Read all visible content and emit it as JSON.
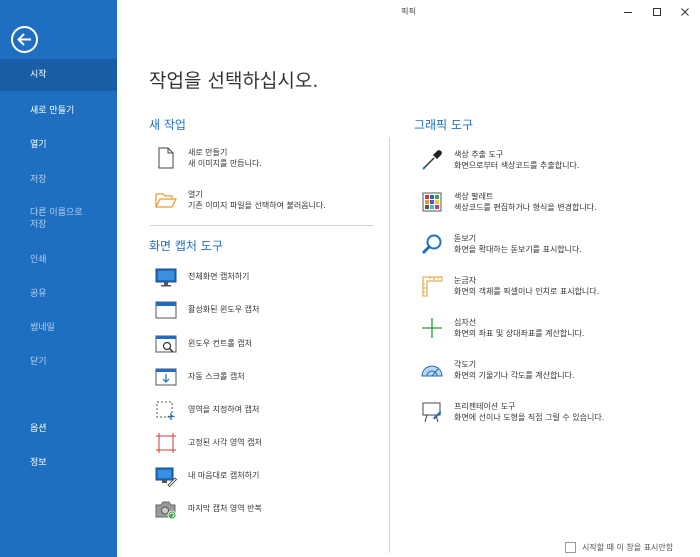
{
  "app": {
    "title": "픽픽"
  },
  "sidebar": {
    "items": [
      {
        "label": "시작"
      },
      {
        "label": "새로 만들기"
      },
      {
        "label": "열기"
      },
      {
        "label": "저장"
      },
      {
        "label": "다른 이름으로\n저장"
      },
      {
        "label": "인쇄"
      },
      {
        "label": "공유"
      },
      {
        "label": "썸네일"
      },
      {
        "label": "닫기"
      },
      {
        "label": "옵션"
      },
      {
        "label": "정보"
      }
    ]
  },
  "main": {
    "heading": "작업을 선택하십시오.",
    "new_task": {
      "title": "새 작업",
      "items": [
        {
          "name": "새로 만들기",
          "desc": "새 이미지를 만듭니다.",
          "icon": "blank-page-icon"
        },
        {
          "name": "열기",
          "desc": "기존 이미지 파일을 선택하여 불러옵니다.",
          "icon": "open-folder-icon"
        }
      ]
    },
    "capture": {
      "title": "화면 캡처 도구",
      "items": [
        {
          "label": "전체화면 캡처하기",
          "icon": "monitor-icon"
        },
        {
          "label": "활성화된 윈도우 캡처",
          "icon": "active-window-icon"
        },
        {
          "label": "윈도우 컨트롤 캡처",
          "icon": "window-control-icon"
        },
        {
          "label": "자동 스크롤 캡처",
          "icon": "scroll-capture-icon"
        },
        {
          "label": "영역을 지정하여 캡처",
          "icon": "region-select-icon"
        },
        {
          "label": "고정된 사각 영역 캡처",
          "icon": "fixed-rect-icon"
        },
        {
          "label": "내 마음대로 캡처하기",
          "icon": "freehand-icon"
        },
        {
          "label": "마지막 캡처 영역 반복",
          "icon": "repeat-camera-icon"
        }
      ]
    },
    "graphic": {
      "title": "그래픽 도구",
      "items": [
        {
          "name": "색상 추출 도구",
          "desc": "화면으로부터 색상코드를 추출합니다.",
          "icon": "eyedropper-icon"
        },
        {
          "name": "색상 팔레트",
          "desc": "색상코드를 편집하거나 형식을 변경합니다.",
          "icon": "palette-icon"
        },
        {
          "name": "돋보기",
          "desc": "화면을 확대하는 돋보기를 표시합니다.",
          "icon": "magnifier-icon"
        },
        {
          "name": "눈금자",
          "desc": "화면의 객체를 픽셀이나 인치로 표시합니다.",
          "icon": "ruler-icon"
        },
        {
          "name": "십자선",
          "desc": "화면의 좌표 및 상대좌표를 계산합니다.",
          "icon": "crosshair-icon"
        },
        {
          "name": "각도기",
          "desc": "화면의 기울기나 각도를 계산합니다.",
          "icon": "protractor-icon"
        },
        {
          "name": "프리젠테이션 도구",
          "desc": "화면에 선이나 도형을 직접 그릴 수 있습니다.",
          "icon": "whiteboard-icon"
        }
      ]
    }
  },
  "footer": {
    "checkbox_label": "시작할 때 이 창을 표시안함"
  }
}
